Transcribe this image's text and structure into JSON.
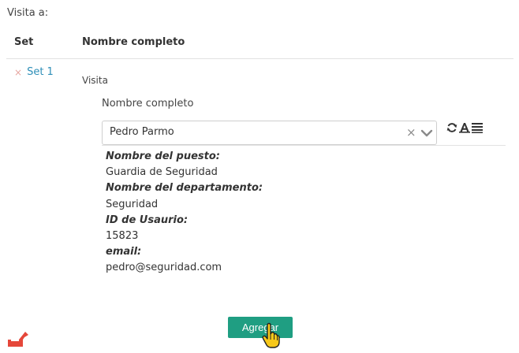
{
  "section": {
    "label": "Visita a:"
  },
  "table": {
    "headers": {
      "set": "Set",
      "name": "Nombre completo"
    },
    "row": {
      "remove_glyph": "×",
      "set_label": "Set 1"
    }
  },
  "form": {
    "group_label": "Visita",
    "field_label": "Nombre completo",
    "select": {
      "value": "Pedro Parmo",
      "clear_glyph": "×"
    }
  },
  "details": {
    "position_label": "Nombre del puesto:",
    "position_value": "Guardia de Seguridad",
    "department_label": "Nombre del departamento:",
    "department_value": "Seguridad",
    "user_id_label": "ID de Usaurio:",
    "user_id_value": "15823",
    "email_label": "email:",
    "email_value": "pedro@seguridad.com"
  },
  "actions": {
    "add_label": "Agregar"
  },
  "colors": {
    "accent": "#1f9e82",
    "link": "#2f8fb8",
    "remove": "#e7a6a1",
    "corner_icon": "#e5473a"
  },
  "icons": [
    "remove-icon",
    "clear-icon",
    "chevron-down-icon",
    "refresh-icon",
    "text-icon",
    "list-icon",
    "hand-cursor-icon",
    "corner-icon"
  ]
}
